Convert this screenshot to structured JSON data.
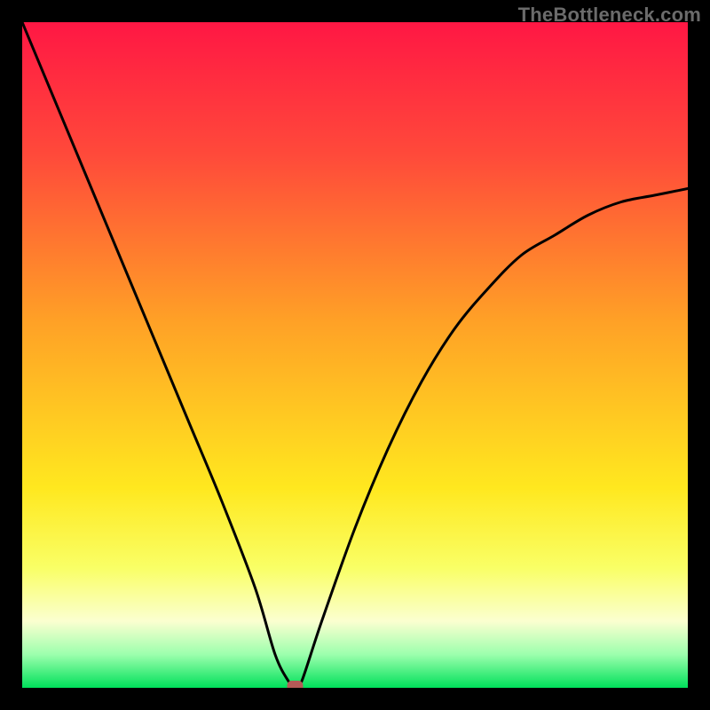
{
  "watermark": "TheBottleneck.com",
  "chart_data": {
    "type": "line",
    "title": "",
    "xlabel": "",
    "ylabel": "",
    "xlim": [
      0,
      100
    ],
    "ylim": [
      0,
      100
    ],
    "grid": false,
    "legend": false,
    "background": {
      "type": "gradient-vertical",
      "stops": [
        {
          "pos": 0.0,
          "color": "#ff1744"
        },
        {
          "pos": 0.2,
          "color": "#ff4a3a"
        },
        {
          "pos": 0.45,
          "color": "#ffa126"
        },
        {
          "pos": 0.7,
          "color": "#ffe81f"
        },
        {
          "pos": 0.82,
          "color": "#f9ff66"
        },
        {
          "pos": 0.9,
          "color": "#fbffd0"
        },
        {
          "pos": 0.95,
          "color": "#9cffad"
        },
        {
          "pos": 1.0,
          "color": "#00e05a"
        }
      ]
    },
    "series": [
      {
        "name": "bottleneck-curve",
        "x": [
          0,
          5,
          10,
          15,
          20,
          25,
          30,
          35,
          38,
          40,
          41,
          42,
          45,
          50,
          55,
          60,
          65,
          70,
          75,
          80,
          85,
          90,
          95,
          100
        ],
        "y": [
          100,
          88,
          76,
          64,
          52,
          40,
          28,
          15,
          5,
          1,
          0,
          1,
          10,
          24,
          36,
          46,
          54,
          60,
          65,
          68,
          71,
          73,
          74,
          75
        ]
      }
    ],
    "marker": {
      "x": 41,
      "y": 0,
      "color": "#b45a57",
      "shape": "rounded-rect"
    }
  }
}
